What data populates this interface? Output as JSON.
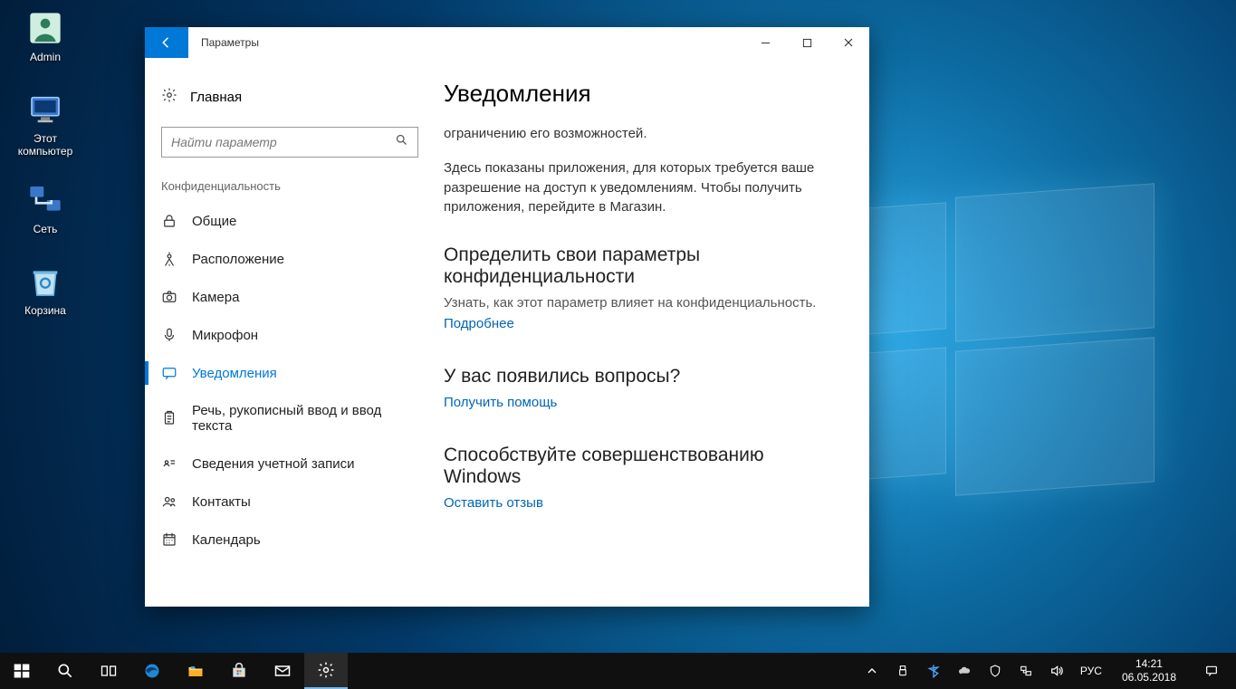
{
  "desktop_icons": {
    "admin": "Admin",
    "this_pc_line1": "Этот",
    "this_pc_line2": "компьютер",
    "network": "Сеть",
    "recycle": "Корзина"
  },
  "window": {
    "title": "Параметры",
    "home": "Главная",
    "search_placeholder": "Найти параметр",
    "group": "Конфиденциальность",
    "nav": {
      "general": "Общие",
      "location": "Расположение",
      "camera": "Камера",
      "microphone": "Микрофон",
      "notifications": "Уведомления",
      "speech": "Речь, рукописный ввод и ввод текста",
      "account": "Сведения учетной записи",
      "contacts": "Контакты",
      "calendar": "Календарь"
    },
    "content": {
      "h1": "Уведомления",
      "p1": "ограничению его возможностей.",
      "p2": "Здесь показаны приложения, для которых требуется ваше разрешение на доступ к уведомлениям. Чтобы получить приложения, перейдите в Магазин.",
      "h2a": "Определить свои параметры конфиденциальности",
      "suba": "Узнать, как этот параметр влияет на конфиденциальность.",
      "linka": "Подробнее",
      "h2b": "У вас появились вопросы?",
      "linkb": "Получить помощь",
      "h2c": "Способствуйте совершенствованию Windows",
      "linkc": "Оставить отзыв"
    }
  },
  "taskbar": {
    "lang": "РУС",
    "time": "14:21",
    "date": "06.05.2018"
  }
}
